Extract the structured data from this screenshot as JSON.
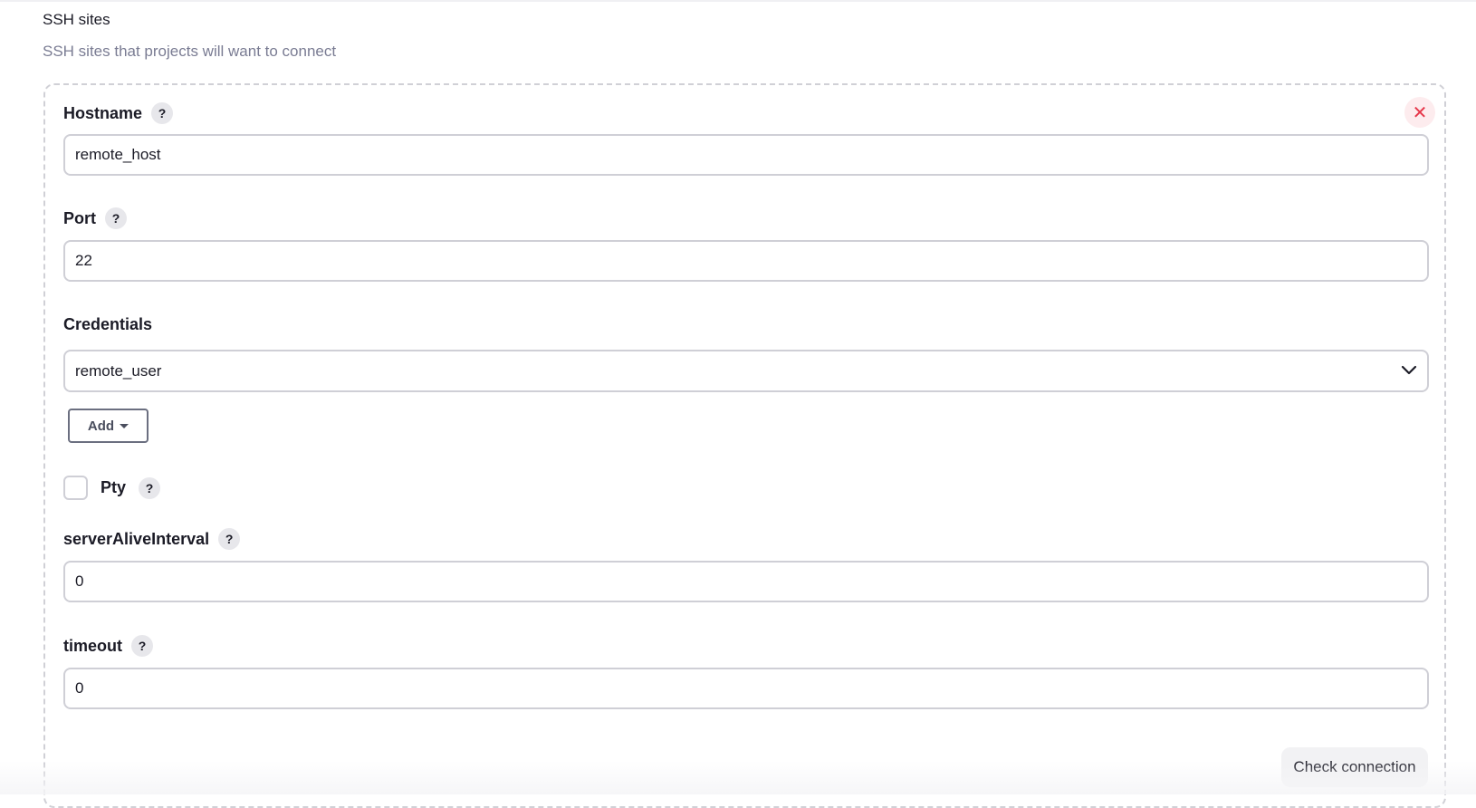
{
  "section": {
    "title": "SSH sites",
    "description": "SSH sites that projects will want to connect"
  },
  "site": {
    "close_icon": "close-icon",
    "hostname": {
      "label": "Hostname",
      "help": "?",
      "value": "remote_host"
    },
    "port": {
      "label": "Port",
      "help": "?",
      "value": "22"
    },
    "credentials": {
      "label": "Credentials",
      "selected": "remote_user",
      "add_label": "Add"
    },
    "pty": {
      "label": "Pty",
      "help": "?",
      "checked": false
    },
    "server_alive_interval": {
      "label": "serverAliveInterval",
      "help": "?",
      "value": "0"
    },
    "timeout": {
      "label": "timeout",
      "help": "?",
      "value": "0"
    },
    "check_connection_label": "Check connection"
  },
  "colors": {
    "close_bg": "#fdecee",
    "close_fg": "#e6374a",
    "description": "#7a7c93",
    "border": "#cfcfd6"
  }
}
